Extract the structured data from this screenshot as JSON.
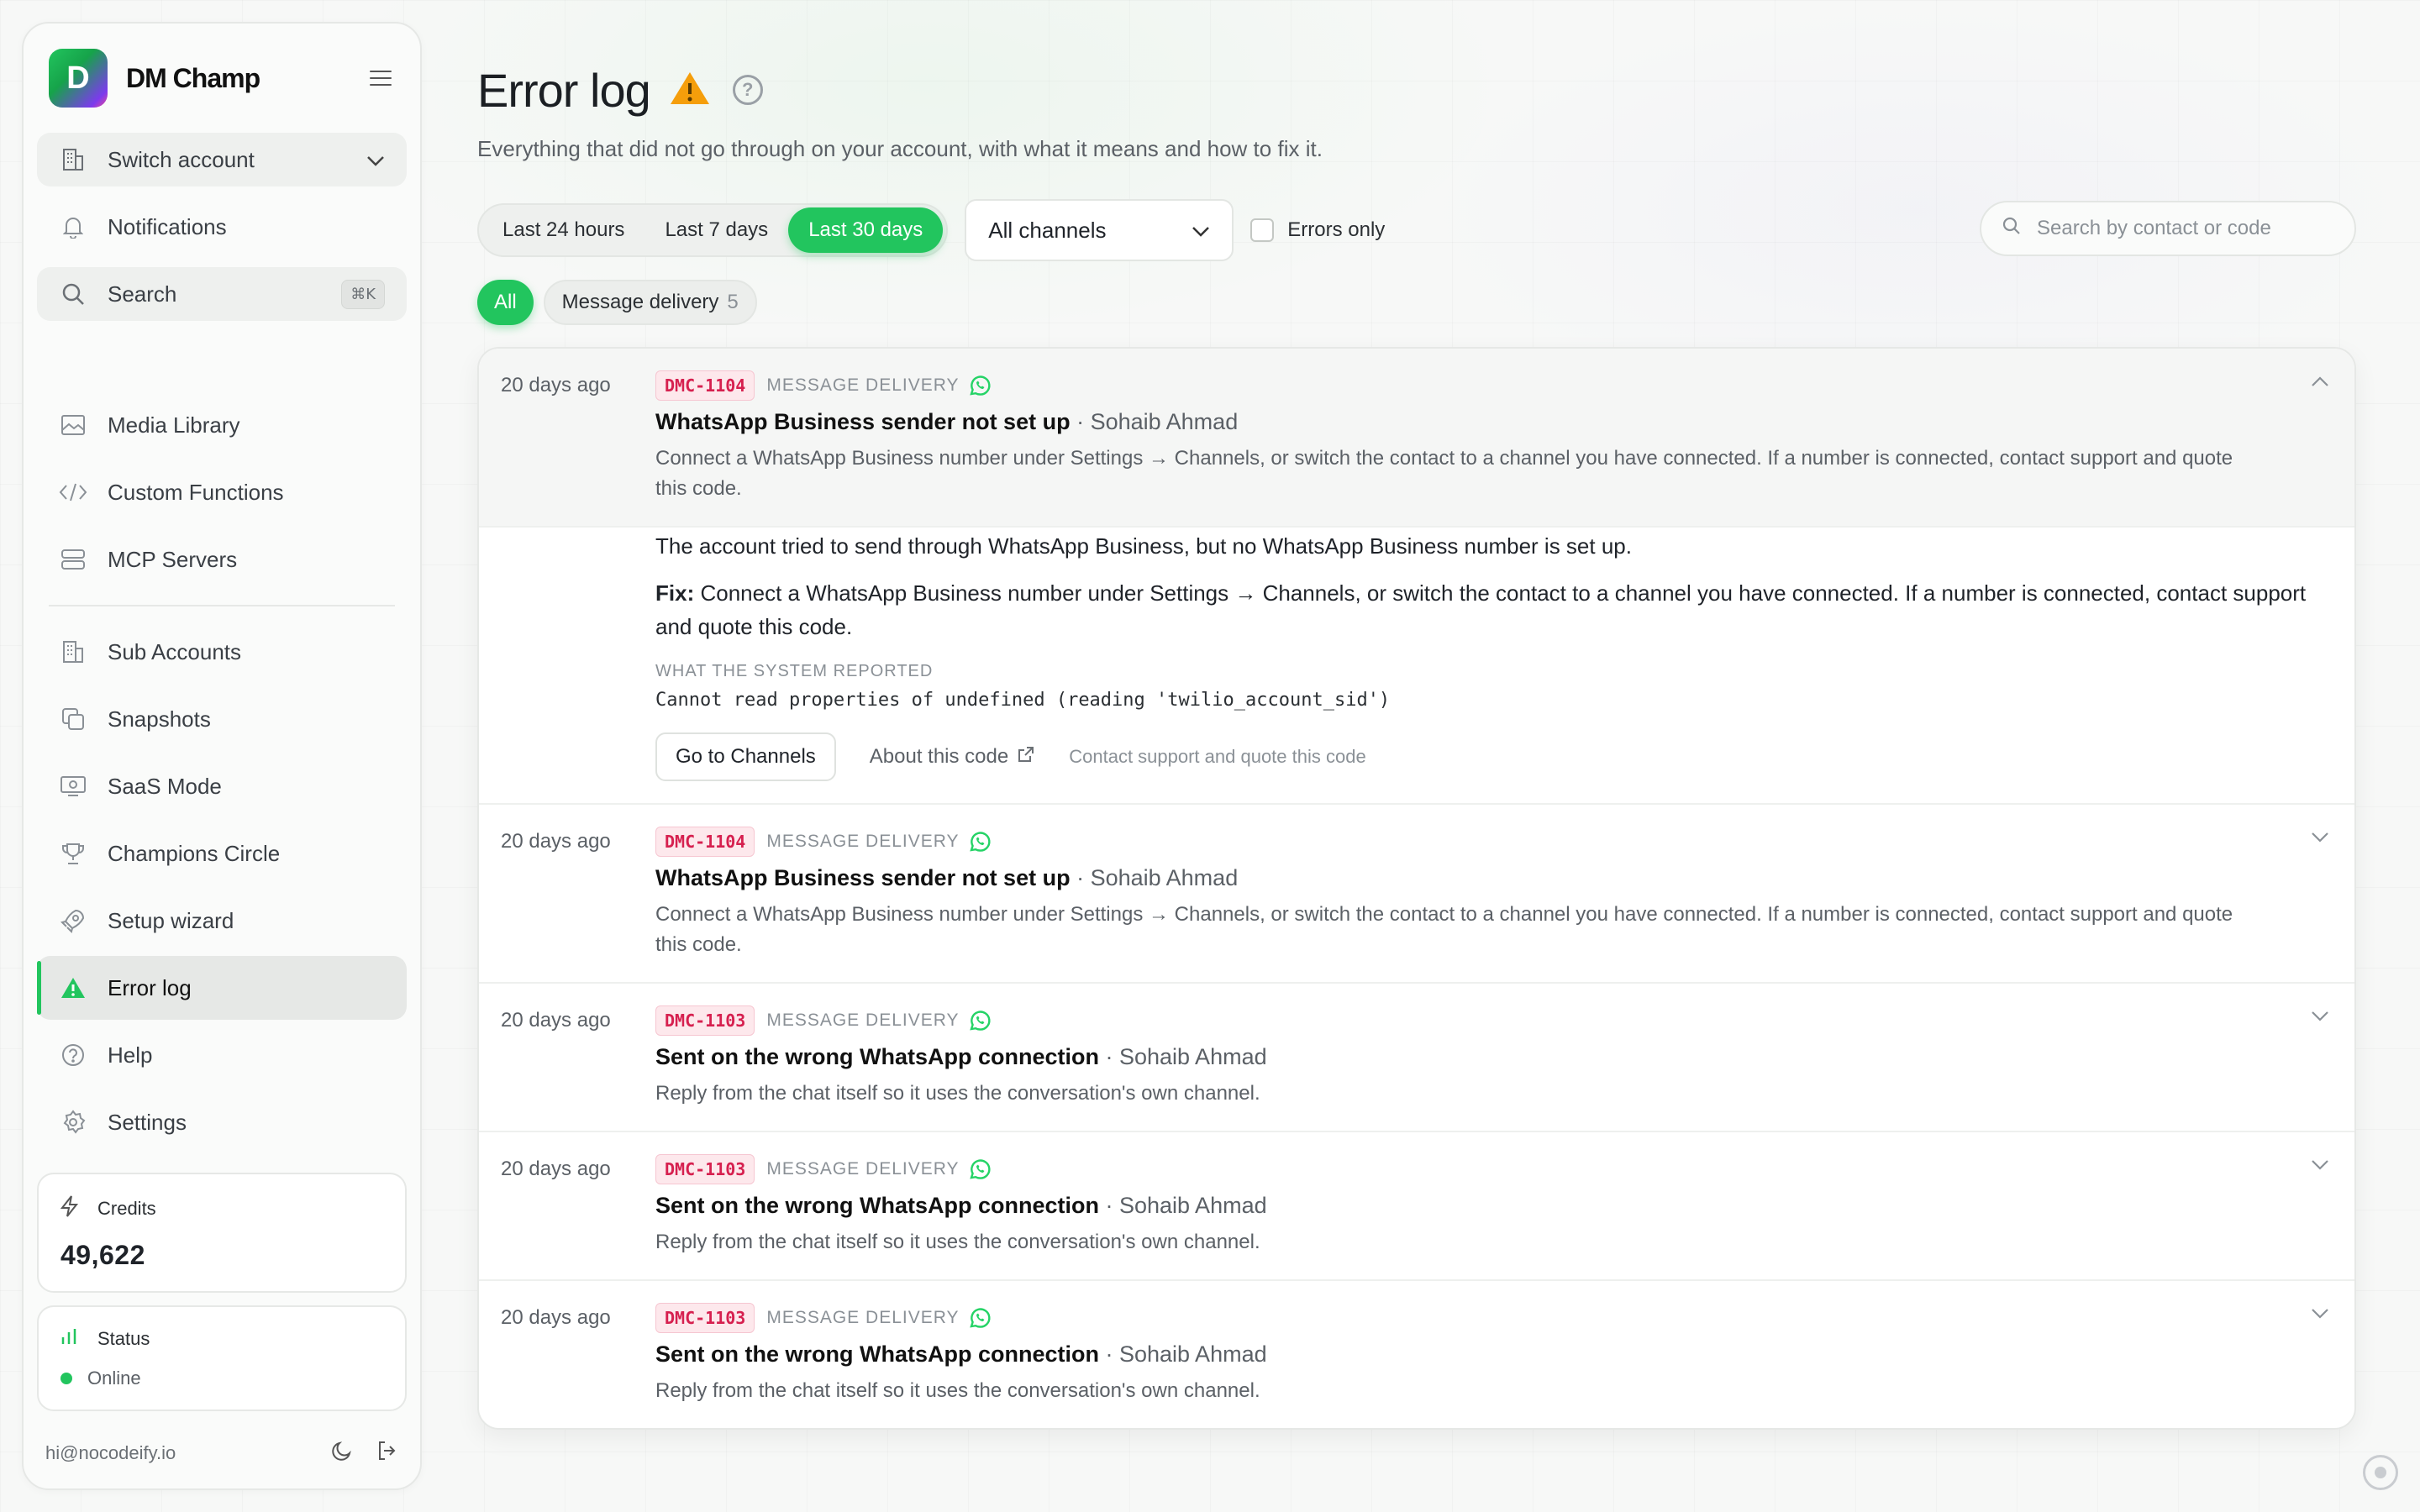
{
  "brand": {
    "name": "DM Champ",
    "logo_letter": "D"
  },
  "sidebar": {
    "switch_account": "Switch account",
    "notifications": "Notifications",
    "search": "Search",
    "search_shortcut": "⌘K",
    "items": [
      {
        "label": "Media Library",
        "icon": "image-icon"
      },
      {
        "label": "Custom Functions",
        "icon": "code-icon"
      },
      {
        "label": "MCP Servers",
        "icon": "server-icon"
      },
      {
        "label": "Sub Accounts",
        "icon": "building-icon"
      },
      {
        "label": "Snapshots",
        "icon": "copy-icon"
      },
      {
        "label": "SaaS Mode",
        "icon": "monitor-icon"
      },
      {
        "label": "Champions Circle",
        "icon": "trophy-icon"
      },
      {
        "label": "Setup wizard",
        "icon": "rocket-icon"
      },
      {
        "label": "Error log",
        "icon": "warning-icon",
        "active": true
      },
      {
        "label": "Help",
        "icon": "help-icon"
      },
      {
        "label": "Settings",
        "icon": "gear-icon"
      }
    ],
    "credits": {
      "label": "Credits",
      "value": "49,622"
    },
    "status": {
      "label": "Status",
      "value": "Online"
    },
    "email": "hi@nocodeify.io"
  },
  "page": {
    "title": "Error log",
    "subtitle": "Everything that did not go through on your account, with what it means and how to fix it."
  },
  "filters": {
    "ranges": [
      "Last 24 hours",
      "Last 7 days",
      "Last 30 days"
    ],
    "selected_range": "Last 30 days",
    "channel": "All channels",
    "errors_only": "Errors only",
    "search_placeholder": "Search by contact or code"
  },
  "chips": {
    "all": "All",
    "message_delivery": "Message delivery",
    "message_delivery_count": "5"
  },
  "errors": [
    {
      "when": "20 days ago",
      "code": "DMC-1104",
      "category": "MESSAGE DELIVERY",
      "title": "WhatsApp Business sender not set up",
      "contact": " · Sohaib Ahmad",
      "summary": "Connect a WhatsApp Business number under Settings → Channels, or switch the contact to a channel you have connected. If a number is connected, contact support and quote this code.",
      "expanded": true
    },
    {
      "when": "20 days ago",
      "code": "DMC-1104",
      "category": "MESSAGE DELIVERY",
      "title": "WhatsApp Business sender not set up",
      "contact": " · Sohaib Ahmad",
      "summary": "Connect a WhatsApp Business number under Settings → Channels, or switch the contact to a channel you have connected. If a number is connected, contact support and quote this code."
    },
    {
      "when": "20 days ago",
      "code": "DMC-1103",
      "category": "MESSAGE DELIVERY",
      "title": "Sent on the wrong WhatsApp connection",
      "contact": " · Sohaib Ahmad",
      "summary": "Reply from the chat itself so it uses the conversation's own channel."
    },
    {
      "when": "20 days ago",
      "code": "DMC-1103",
      "category": "MESSAGE DELIVERY",
      "title": "Sent on the wrong WhatsApp connection",
      "contact": " · Sohaib Ahmad",
      "summary": "Reply from the chat itself so it uses the conversation's own channel."
    },
    {
      "when": "20 days ago",
      "code": "DMC-1103",
      "category": "MESSAGE DELIVERY",
      "title": "Sent on the wrong WhatsApp connection",
      "contact": " · Sohaib Ahmad",
      "summary": "Reply from the chat itself so it uses the conversation's own channel."
    }
  ],
  "detail": {
    "explanation": "The account tried to send through WhatsApp Business, but no WhatsApp Business number is set up.",
    "fix_label": "Fix:",
    "fix_text": " Connect a WhatsApp Business number under Settings → Channels, or switch the contact to a channel you have connected. If a number is connected, contact support and quote this code.",
    "system_label": "WHAT THE SYSTEM REPORTED",
    "system_message": "Cannot read properties of undefined (reading 'twilio_account_sid')",
    "go_button": "Go to Channels",
    "about_link": "About this code",
    "support_text": "Contact support and quote this code"
  },
  "colors": {
    "accent": "#22c55e",
    "code_red": "#d6204f",
    "whatsapp": "#25d366"
  }
}
